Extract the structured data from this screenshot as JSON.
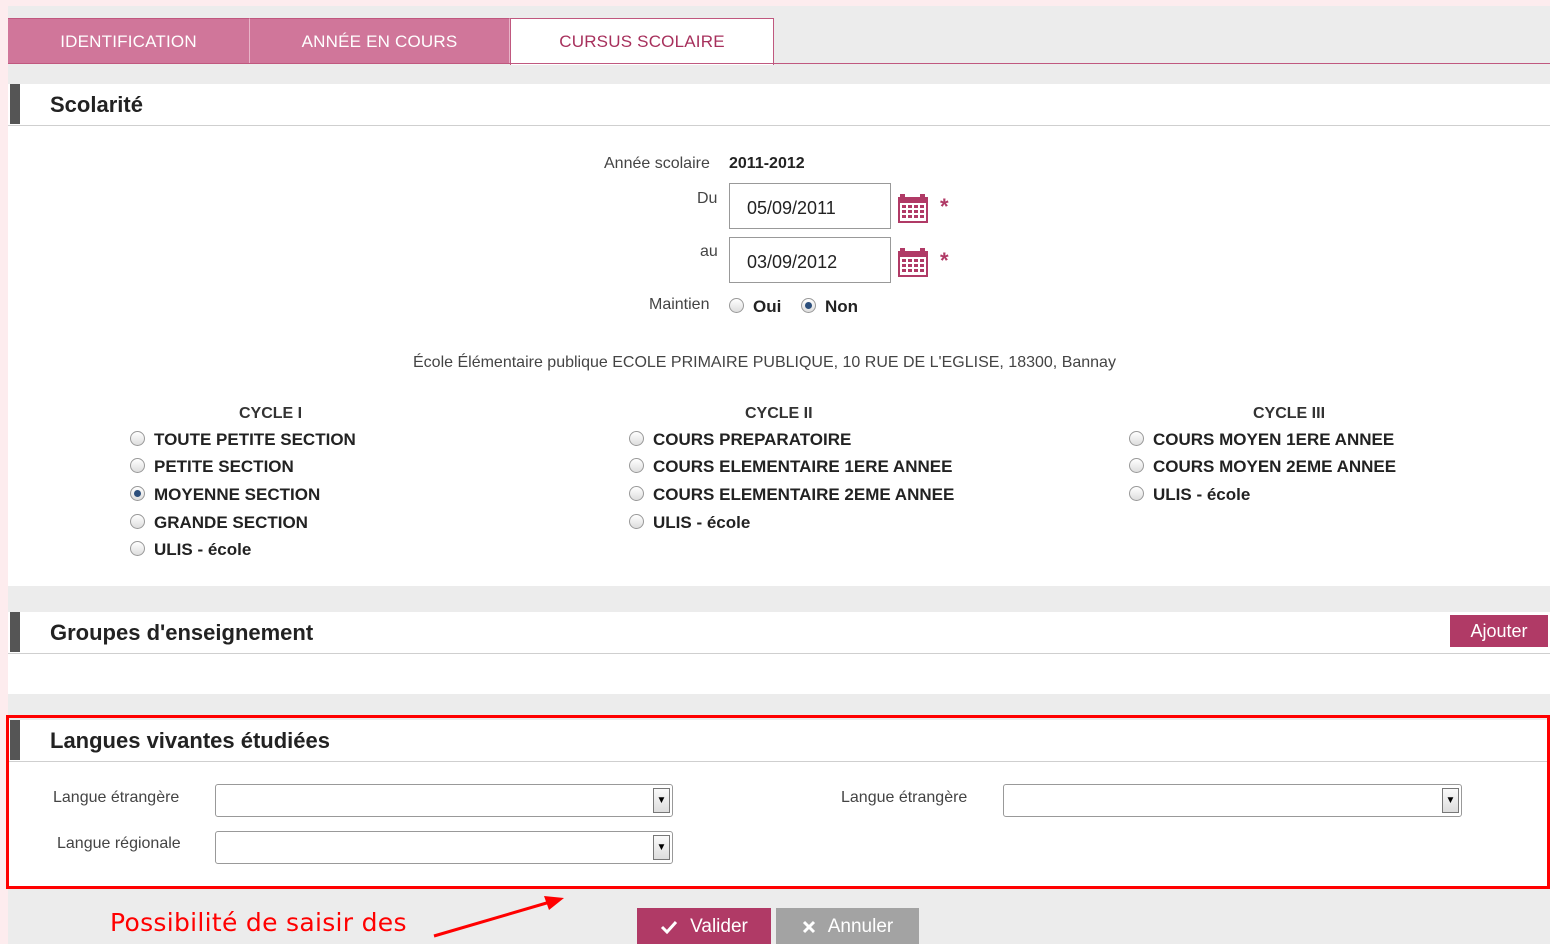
{
  "tabs": [
    {
      "label": "IDENTIFICATION",
      "active": false
    },
    {
      "label": "ANNÉE EN COURS",
      "active": false
    },
    {
      "label": "CURSUS SCOLAIRE",
      "active": true
    }
  ],
  "scolarite": {
    "title": "Scolarité",
    "annee_label": "Année scolaire",
    "annee_value": "2011-2012",
    "du_label": "Du",
    "du_value": "05/09/2011",
    "au_label": "au",
    "au_value": "03/09/2012",
    "required_mark": "*",
    "maintien_label": "Maintien",
    "maintien_options": [
      "Oui",
      "Non"
    ],
    "maintien_selected": "Non",
    "ecole": "École Élémentaire publique ECOLE PRIMAIRE PUBLIQUE, 10 RUE DE L'EGLISE, 18300, Bannay",
    "cycles": [
      {
        "title": "CYCLE I",
        "options": [
          "TOUTE PETITE SECTION",
          "PETITE SECTION",
          "MOYENNE SECTION",
          "GRANDE SECTION",
          "ULIS - école"
        ]
      },
      {
        "title": "CYCLE II",
        "options": [
          "COURS PREPARATOIRE",
          "COURS ELEMENTAIRE 1ERE ANNEE",
          "COURS ELEMENTAIRE 2EME ANNEE",
          "ULIS - école"
        ]
      },
      {
        "title": "CYCLE III",
        "options": [
          "COURS MOYEN 1ERE ANNEE",
          "COURS MOYEN 2EME ANNEE",
          "ULIS - école"
        ]
      }
    ],
    "selected_level": "MOYENNE SECTION"
  },
  "groupes": {
    "title": "Groupes d'enseignement",
    "add_label": "Ajouter"
  },
  "langues": {
    "title": "Langues vivantes étudiées",
    "etrangere_label_1": "Langue étrangère",
    "etrangere_value_1": "",
    "etrangere_label_2": "Langue étrangère",
    "etrangere_value_2": "",
    "regionale_label": "Langue régionale",
    "regionale_value": ""
  },
  "actions": {
    "validate_label": "Valider",
    "cancel_label": "Annuler"
  },
  "annotation": {
    "text": "Possibilité de saisir des",
    "color": "#ff0000"
  },
  "colors": {
    "accent": "#b03a66",
    "tab_bg": "#d0769a",
    "highlight_border": "#ff0000"
  }
}
